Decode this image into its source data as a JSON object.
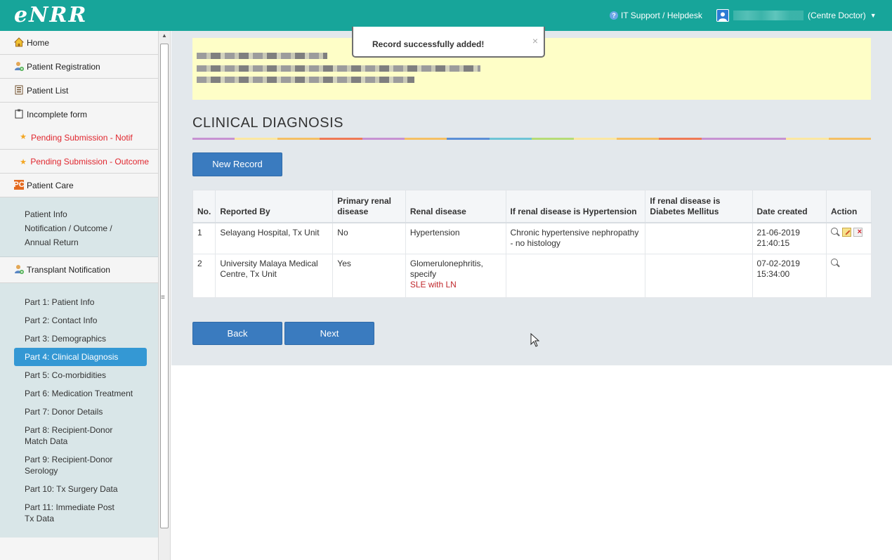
{
  "header": {
    "brand": "eNRR",
    "help_label": "IT Support / Helpdesk",
    "user_role": "(Centre Doctor)"
  },
  "sidebar": {
    "items": [
      {
        "label": "Home",
        "icon": "home-icon"
      },
      {
        "label": "Patient Registration",
        "icon": "user-add-icon"
      },
      {
        "label": "Patient List",
        "icon": "list-icon"
      },
      {
        "label": "Incomplete form",
        "icon": "clipboard-icon"
      }
    ],
    "pending": [
      {
        "label": "Pending Submission - Notif"
      },
      {
        "label": "Pending Submission - Outcome"
      }
    ],
    "patient_care": {
      "label": "Patient Care",
      "sub": [
        "Patient Info",
        "Notification / Outcome / Annual Return"
      ]
    },
    "transplant": {
      "label": "Transplant Notification",
      "parts": [
        "Part 1: Patient Info",
        "Part 2: Contact Info",
        "Part 3: Demographics",
        "Part 4: Clinical Diagnosis",
        "Part 5: Co-morbidities",
        "Part 6: Medication Treatment",
        "Part 7: Donor Details",
        "Part 8: Recipient-Donor Match Data",
        "Part 9: Recipient-Donor Serology",
        "Part 10: Tx Surgery Data",
        "Part 11: Immediate Post Tx Data"
      ],
      "active_index": 3
    }
  },
  "toast": {
    "message": "Record successfully added!",
    "close": "×"
  },
  "main": {
    "title": "CLINICAL DIAGNOSIS",
    "new_record_label": "New Record",
    "back_label": "Back",
    "next_label": "Next"
  },
  "table": {
    "headers": [
      "No.",
      "Reported By",
      "Primary renal disease",
      "Renal disease",
      "If renal disease is Hypertension",
      "If renal disease is Diabetes Mellitus",
      "Date created",
      "Action"
    ],
    "rows": [
      {
        "no": "1",
        "reported_by": "Selayang Hospital, Tx Unit",
        "primary": "No",
        "renal_disease": "Hypertension",
        "renal_specify": "",
        "hypertension": "Chronic hypertensive nephropathy - no histology",
        "diabetes": "",
        "date": "21-06-2019",
        "time": "21:40:15",
        "actions": [
          "view-icon",
          "edit-icon",
          "delete-icon"
        ]
      },
      {
        "no": "2",
        "reported_by": "University Malaya Medical Centre, Tx Unit",
        "primary": "Yes",
        "renal_disease": "Glomerulonephritis, specify",
        "renal_specify": "SLE with LN",
        "hypertension": "",
        "diabetes": "",
        "date": "07-02-2019",
        "time": "15:34:00",
        "actions": [
          "view-icon"
        ]
      }
    ]
  },
  "colors": {
    "topbar": "#17a59a",
    "primary_button": "#3a7bbf",
    "active_nav": "#3498d4",
    "alert_text": "#e0262e",
    "banner": "#fefec7"
  }
}
